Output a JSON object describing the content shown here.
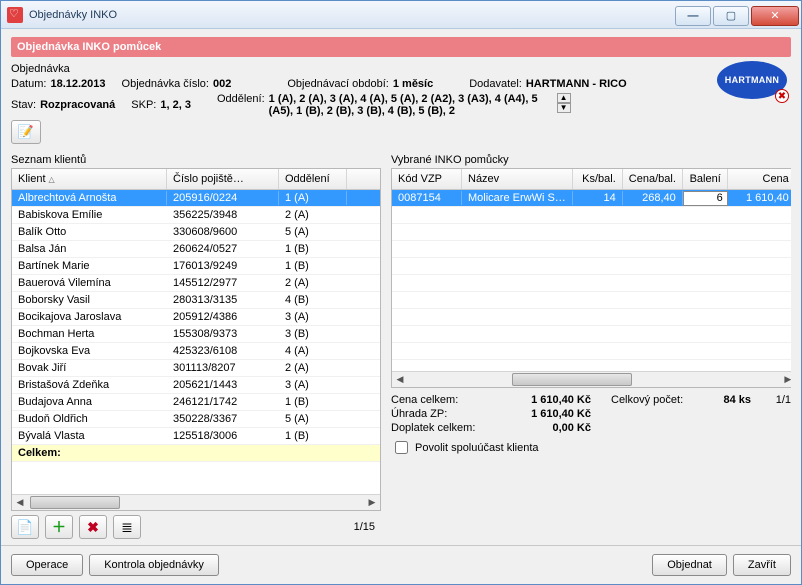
{
  "window": {
    "title": "Objednávky INKO"
  },
  "header": {
    "banner": "Objednávka INKO pomůcek",
    "section_label": "Objednávka",
    "datum_label": "Datum:",
    "datum": "18.12.2013",
    "cislo_label": "Objednávka číslo:",
    "cislo": "002",
    "obdobi_label": "Objednávací období:",
    "obdobi": "1 měsíc",
    "dodavatel_label": "Dodavatel:",
    "dodavatel": "HARTMANN - RICO",
    "stav_label": "Stav:",
    "stav": "Rozpracovaná",
    "skp_label": "SKP:",
    "skp": "1, 2, 3",
    "oddeleni_label": "Oddělení:",
    "oddeleni": "1 (A), 2 (A), 3 (A), 4 (A), 5 (A), 2 (A2), 3 (A3), 4 (A4), 5 (A5), 1 (B), 2 (B), 3 (B), 4 (B), 5 (B), 2",
    "logo_text": "HARTMANN"
  },
  "clients": {
    "title": "Seznam klientů",
    "cols": {
      "klient": "Klient",
      "pojistne": "Číslo pojiště…",
      "oddeleni": "Oddělení"
    },
    "total_label": "Celkem:",
    "page": "1/15",
    "rows": [
      {
        "k": "Albrechtová Arnošta",
        "p": "205916/0224",
        "o": "1 (A)"
      },
      {
        "k": "Babiskova Emílie",
        "p": "356225/3948",
        "o": "2 (A)"
      },
      {
        "k": "Balík Otto",
        "p": "330608/9600",
        "o": "5 (A)"
      },
      {
        "k": "Balsa Ján",
        "p": "260624/0527",
        "o": "1 (B)"
      },
      {
        "k": "Bartínek Marie",
        "p": "176013/9249",
        "o": "1 (B)"
      },
      {
        "k": "Bauerová Vilemína",
        "p": "145512/2977",
        "o": "2 (A)"
      },
      {
        "k": "Boborsky Vasil",
        "p": "280313/3135",
        "o": "4 (B)"
      },
      {
        "k": "Bocikajova Jaroslava",
        "p": "205912/4386",
        "o": "3 (A)"
      },
      {
        "k": "Bochman Herta",
        "p": "155308/9373",
        "o": "3 (B)"
      },
      {
        "k": "Bojkovska Eva",
        "p": "425323/6108",
        "o": "4 (A)"
      },
      {
        "k": "Bovak Jiří",
        "p": "301113/8207",
        "o": "2 (A)"
      },
      {
        "k": "Bristašová Zdeňka",
        "p": "205621/1443",
        "o": "3 (A)"
      },
      {
        "k": "Budajova Anna",
        "p": "246121/1742",
        "o": "1 (B)"
      },
      {
        "k": "Budoň Oldřich",
        "p": "350228/3367",
        "o": "5 (A)"
      },
      {
        "k": "Bývalá Vlasta",
        "p": "125518/3006",
        "o": "1 (B)"
      }
    ]
  },
  "items": {
    "title": "Vybrané INKO pomůcky",
    "cols": {
      "kod": "Kód VZP",
      "nazev": "Název",
      "ksbal": "Ks/bal.",
      "cenabal": "Cena/bal.",
      "baleni": "Balení",
      "cena": "Cena"
    },
    "rows": [
      {
        "kod": "0087154",
        "naz": "Molicare ErwWi S…",
        "ksb": "14",
        "cb": "268,40",
        "bal": "6",
        "cena": "1 610,40"
      }
    ],
    "page": "1/1"
  },
  "summary": {
    "cena_celkem_label": "Cena celkem:",
    "cena_celkem": "1 610,40 Kč",
    "pocet_label": "Celkový počet:",
    "pocet": "84 ks",
    "uhrada_label": "Úhrada ZP:",
    "uhrada": "1 610,40 Kč",
    "doplatek_label": "Doplatek celkem:",
    "doplatek": "0,00 Kč",
    "povolit_label": "Povolit spoluúčast klienta"
  },
  "footer": {
    "operace": "Operace",
    "kontrola": "Kontrola objednávky",
    "objednat": "Objednat",
    "zavrit": "Zavřít"
  }
}
